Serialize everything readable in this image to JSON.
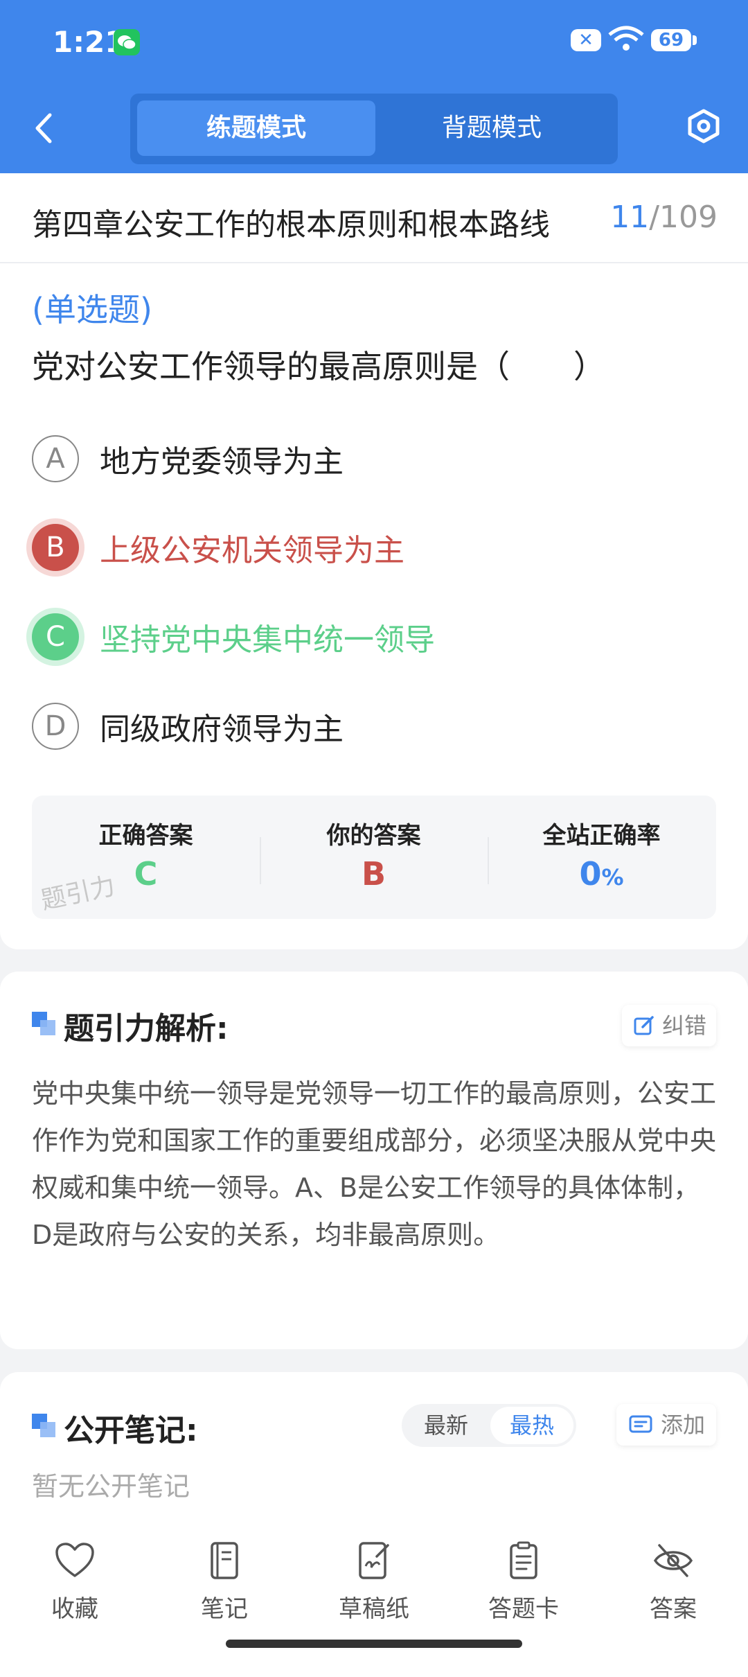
{
  "status": {
    "time": "1:21",
    "battery": "69",
    "notif_badge": "✕"
  },
  "header": {
    "tabs": [
      {
        "label": "练题模式",
        "active": true
      },
      {
        "label": "背题模式",
        "active": false
      }
    ]
  },
  "chapter": {
    "title": "第四章公安工作的根本原则和根本路线",
    "current": "11",
    "total": "/109"
  },
  "question": {
    "type": "(单选题)",
    "text": "党对公安工作领导的最高原则是（　　）",
    "options": [
      {
        "letter": "A",
        "text": "地方党委领导为主",
        "state": "normal"
      },
      {
        "letter": "B",
        "text": "上级公安机关领导为主",
        "state": "wrong"
      },
      {
        "letter": "C",
        "text": "坚持党中央集中统一领导",
        "state": "correct"
      },
      {
        "letter": "D",
        "text": "同级政府领导为主",
        "state": "normal"
      }
    ]
  },
  "answers": {
    "correct_label": "正确答案",
    "correct_value": "C",
    "yours_label": "你的答案",
    "yours_value": "B",
    "rate_label": "全站正确率",
    "rate_value": "0",
    "rate_unit": "%",
    "watermark": "题引力"
  },
  "analysis": {
    "title": "题引力解析:",
    "report_label": "纠错",
    "text": "党中央集中统一领导是党领导一切工作的最高原则，公安工作作为党和国家工作的重要组成部分，必须坚决服从党中央权威和集中统一领导。A、B是公安工作领导的具体体制，D是政府与公安的关系，均非最高原则。"
  },
  "notes": {
    "title": "公开笔记:",
    "sort_latest": "最新",
    "sort_hot": "最热",
    "add_label": "添加",
    "empty": "暂无公开笔记"
  },
  "bottom_nav": [
    {
      "label": "收藏",
      "icon": "heart-icon"
    },
    {
      "label": "笔记",
      "icon": "notebook-icon"
    },
    {
      "label": "草稿纸",
      "icon": "draft-icon"
    },
    {
      "label": "答题卡",
      "icon": "answer-card-icon"
    },
    {
      "label": "答案",
      "icon": "eye-off-icon"
    }
  ],
  "colors": {
    "primary": "#3f86ec",
    "wrong": "#c9504a",
    "correct": "#5ccf8a"
  }
}
